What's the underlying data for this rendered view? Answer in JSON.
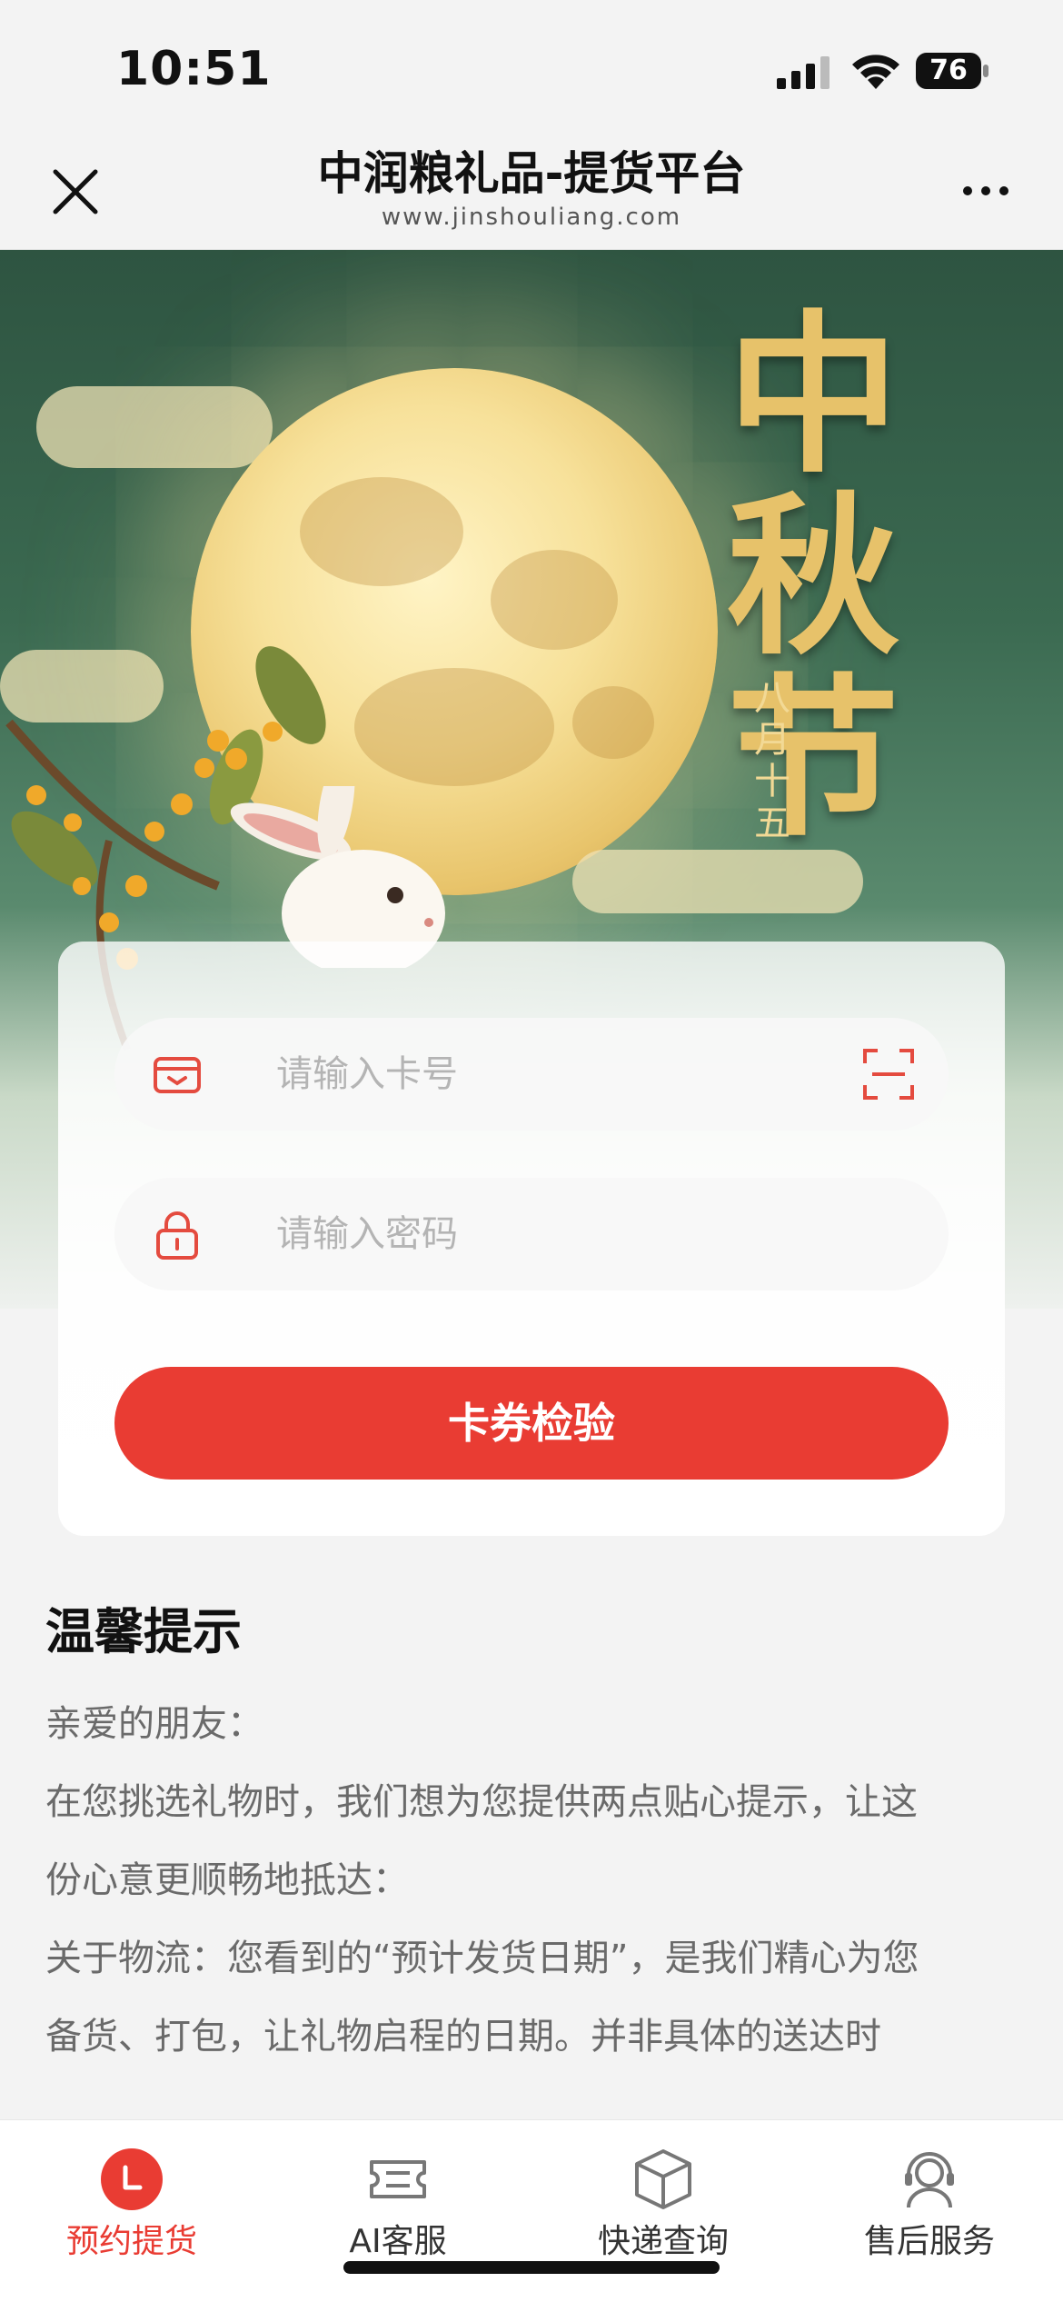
{
  "status_bar": {
    "time": "10:51",
    "battery": "76"
  },
  "nav": {
    "title": "中润粮礼品-提货平台",
    "url": "www.jinshouliang.com"
  },
  "banner": {
    "title_art": "中秋节",
    "date_art": "八月十五"
  },
  "form": {
    "card_placeholder": "请输入卡号",
    "password_placeholder": "请输入密码",
    "submit_label": "卡券检验"
  },
  "tips": {
    "title": "温馨提示",
    "paragraphs": [
      "亲爱的朋友：",
      "在您挑选礼物时，我们想为您提供两点贴心提示，让这",
      "份心意更顺畅地抵达：",
      "关于物流：您看到的“预计发货日期”，是我们精心为您",
      "备货、打包，让礼物启程的日期。并非具体的送达时"
    ]
  },
  "tabbar": {
    "items": [
      {
        "label": "预约提货",
        "icon": "home-icon",
        "active": true
      },
      {
        "label": "AI客服",
        "icon": "ticket-icon",
        "active": false
      },
      {
        "label": "快递查询",
        "icon": "package-icon",
        "active": false
      },
      {
        "label": "售后服务",
        "icon": "headset-icon",
        "active": false
      }
    ]
  },
  "colors": {
    "accent": "#e93c33",
    "banner_green": "#2e5441",
    "gold": "#e7c26a"
  }
}
